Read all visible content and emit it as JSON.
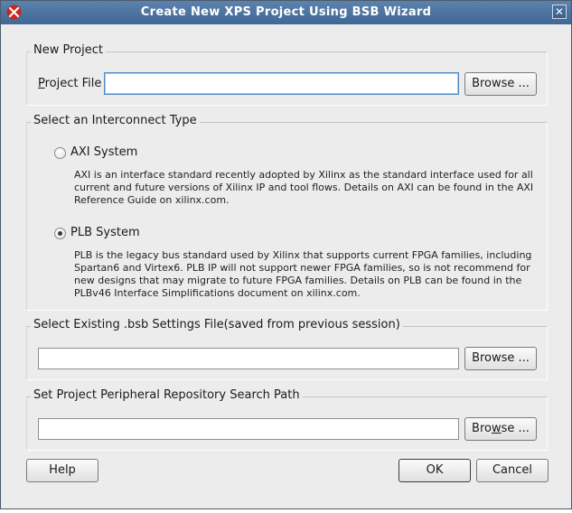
{
  "window": {
    "title": "Create New XPS Project Using BSB Wizard",
    "icon": "xilinx-logo-icon",
    "close_glyph": "✕"
  },
  "new_project": {
    "legend": "New Project",
    "project_file_label_mnemonic": "P",
    "project_file_label_rest": "roject File",
    "project_file_value": "",
    "browse_label": "Browse ..."
  },
  "interconnect": {
    "legend": "Select an Interconnect Type",
    "selected": "PLB System",
    "options": [
      {
        "label": "AXI System",
        "selected": false,
        "description": [
          "AXI is an interface standard recently adopted by Xilinx as the standard interface used for all",
          "current and future versions of Xilinx IP and tool flows.  Details on AXI can be found in the AXI",
          "Reference Guide on xilinx.com."
        ]
      },
      {
        "label": "PLB System",
        "selected": true,
        "description": [
          "PLB is the legacy bus standard used by Xilinx that supports current FPGA families, including",
          "Spartan6 and Virtex6.  PLB IP will not support newer FPGA families, so is not recommend for",
          "new designs that may migrate to future FPGA families.  Details on PLB can be found in the",
          "PLBv46 Interface Simplifications document on xilinx.com."
        ]
      }
    ]
  },
  "bsb_settings": {
    "legend": "Select Existing .bsb Settings File(saved from previous session)",
    "value": "",
    "browse_label": "Browse ..."
  },
  "repo_path": {
    "legend": "Set Project Peripheral Repository Search Path",
    "value": "",
    "browse_pre": "Bro",
    "browse_mnemonic": "w",
    "browse_post": "se ..."
  },
  "footer": {
    "help_label": "Help",
    "ok_label": "OK",
    "cancel_label": "Cancel"
  },
  "colors": {
    "titlebar": "#3f6896",
    "dialog_bg": "#ececec",
    "focus_border": "#4f86c4",
    "logo_red": "#c8281e"
  }
}
